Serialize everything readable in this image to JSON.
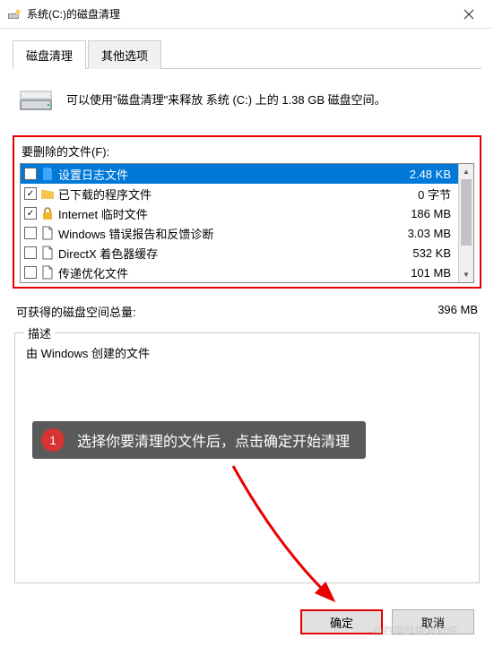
{
  "titlebar": {
    "title": "系统(C:)的磁盘清理"
  },
  "tabs": {
    "active": "磁盘清理",
    "inactive": "其他选项"
  },
  "intro": {
    "text": "可以使用\"磁盘清理\"来释放 系统 (C:) 上的 1.38 GB 磁盘空间。"
  },
  "files_label": "要删除的文件(F):",
  "files": [
    {
      "checked": false,
      "selected": true,
      "icon": "page-blue",
      "label": "设置日志文件",
      "size": "2.48 KB"
    },
    {
      "checked": true,
      "selected": false,
      "icon": "folder",
      "label": "已下载的程序文件",
      "size": "0 字节"
    },
    {
      "checked": true,
      "selected": false,
      "icon": "lock",
      "label": "Internet 临时文件",
      "size": "186 MB"
    },
    {
      "checked": false,
      "selected": false,
      "icon": "page",
      "label": "Windows 错误报告和反馈诊断",
      "size": "3.03 MB"
    },
    {
      "checked": false,
      "selected": false,
      "icon": "page",
      "label": "DirectX 着色器缓存",
      "size": "532 KB"
    },
    {
      "checked": false,
      "selected": false,
      "icon": "page",
      "label": "传递优化文件",
      "size": "101 MB"
    }
  ],
  "total": {
    "label": "可获得的磁盘空间总量:",
    "value": "396 MB"
  },
  "desc": {
    "legend": "描述",
    "text": "由 Windows 创建的文件"
  },
  "callout": {
    "num": "1",
    "text": "选择你要清理的文件后，点击确定开始清理"
  },
  "buttons": {
    "ok": "确定",
    "cancel": "取消"
  },
  "watermark": "@数据蛙恢复软件"
}
